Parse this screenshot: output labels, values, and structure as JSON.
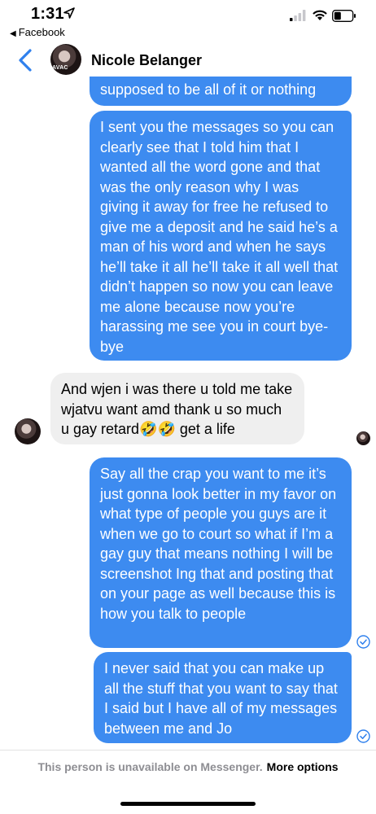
{
  "status_bar": {
    "time": "1:31",
    "back_app": "Facebook"
  },
  "header": {
    "contact_name": "Nicole Belanger",
    "avatar_tag": "AVAC"
  },
  "messages": [
    {
      "direction": "outgoing",
      "text": "supposed to be all of it or nothing"
    },
    {
      "direction": "outgoing",
      "text": "I sent you the messages so you can clearly see that I told him that I wanted all the word gone and that was the only reason why I was giving it away for free he refused to give me a deposit and he said he’s a man of his word and when he says he’ll take it all he’ll take it all well that didn’t happen so now you can leave me alone because now you’re harassing me see you in court bye-bye"
    },
    {
      "direction": "incoming",
      "text": "And wjen i was there u told me take wjatvu want amd thank u so much u gay retard🤣🤣 get a life"
    },
    {
      "direction": "outgoing",
      "text": "Say all the crap you want to me it’s just gonna look better in my favor on what type of people you guys are it when we go to court so what if I’m a gay guy that means nothing I will be screenshot Ing that and posting that on your page as well because this is how you talk to people"
    },
    {
      "direction": "outgoing",
      "text": "I never said that you can make up all the stuff that you want to say that I said but I have all of my messages between me and Jo"
    }
  ],
  "footer": {
    "unavailable_text": "This person is unavailable on Messenger.",
    "more_options": "More options"
  },
  "colors": {
    "outgoing_bubble": "#3d8bf0",
    "incoming_bubble": "#efefef",
    "accent": "#2f80ed"
  }
}
